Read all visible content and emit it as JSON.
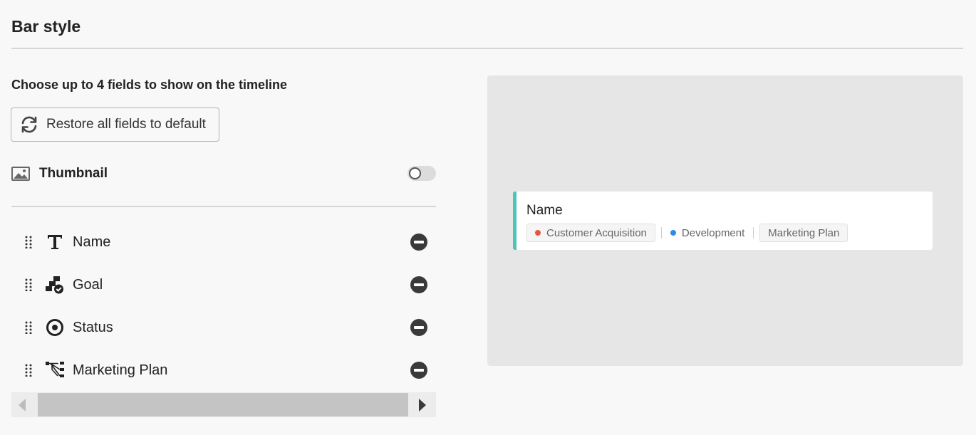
{
  "header": {
    "title": "Bar style"
  },
  "fields_panel": {
    "subtitle": "Choose up to 4 fields to show on the timeline",
    "restore_label": "Restore all fields to default",
    "thumbnail": {
      "label": "Thumbnail",
      "enabled": false,
      "icon": "image-icon"
    },
    "fields": [
      {
        "label": "Name",
        "icon": "text-icon"
      },
      {
        "label": "Goal",
        "icon": "goal-icon"
      },
      {
        "label": "Status",
        "icon": "status-icon"
      },
      {
        "label": "Marketing Plan",
        "icon": "hierarchy-icon"
      }
    ]
  },
  "preview": {
    "bar_name": "Name",
    "accent_color": "#4ac6b9",
    "tags": [
      {
        "label": "Customer Acquisition",
        "dot_color": "#e8553e",
        "boxed": true
      },
      {
        "label": "Development",
        "dot_color": "#2d8ce6",
        "boxed": false
      },
      {
        "label": "Marketing Plan",
        "dot_color": null,
        "boxed": true
      }
    ]
  }
}
